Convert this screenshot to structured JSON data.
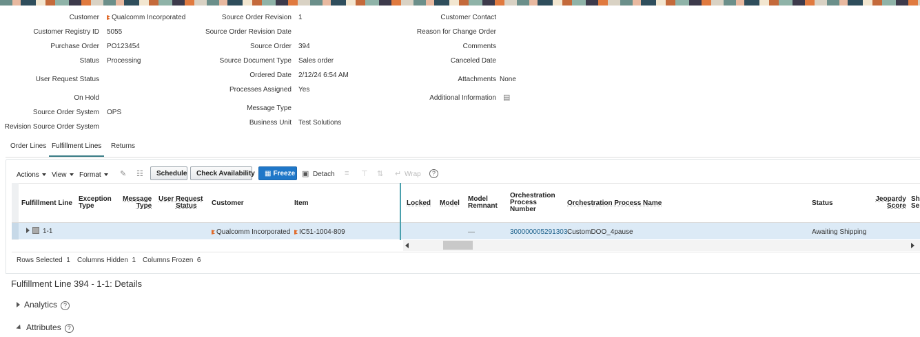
{
  "header_fields": {
    "col1": [
      {
        "label": "Customer",
        "value": "Qualcomm Incorporated"
      },
      {
        "label": "Customer Registry ID",
        "value": "5055"
      },
      {
        "label": "Purchase Order",
        "value": "PO123454"
      },
      {
        "label": "Status",
        "value": "Processing"
      },
      {
        "label": "User Request Status",
        "value": ""
      },
      {
        "label": "On Hold",
        "value": ""
      },
      {
        "label": "Source Order System",
        "value": "OPS"
      },
      {
        "label": "Revision Source Order System",
        "value": ""
      }
    ],
    "col2": [
      {
        "label": "Source Order Revision",
        "value": "1"
      },
      {
        "label": "Source Order Revision Date",
        "value": ""
      },
      {
        "label": "Source Order",
        "value": "394"
      },
      {
        "label": "Source Document Type",
        "value": "Sales order"
      },
      {
        "label": "Ordered Date",
        "value": "2/12/24 6:54 AM"
      },
      {
        "label": "Processes Assigned",
        "value": "Yes"
      },
      {
        "label": "Message Type",
        "value": ""
      },
      {
        "label": "Business Unit",
        "value": "Test Solutions"
      }
    ],
    "col3": [
      {
        "label": "Customer Contact",
        "value": ""
      },
      {
        "label": "Reason for Change Order",
        "value": ""
      },
      {
        "label": "Comments",
        "value": ""
      },
      {
        "label": "Canceled Date",
        "value": ""
      },
      {
        "label": "Attachments",
        "value": "None"
      },
      {
        "label": "Additional Information",
        "value": ""
      }
    ]
  },
  "tabs": [
    "Order Lines",
    "Fulfillment Lines",
    "Returns"
  ],
  "toolbar": {
    "actions": "Actions",
    "view": "View",
    "format": "Format",
    "schedule": "Schedule",
    "check_availability": "Check Availability",
    "freeze": "Freeze",
    "detach": "Detach",
    "wrap": "Wrap"
  },
  "columns": {
    "fulfillment_line": "Fulfillment Line",
    "exception_type_1": "Exception",
    "exception_type_2": "Type",
    "message_type_1": "Message",
    "message_type_2": "Type",
    "user_request_1": "User Request",
    "user_request_2": "Status",
    "customer": "Customer",
    "item": "Item",
    "locked": "Locked",
    "model": "Model",
    "model_remnant_1": "Model",
    "model_remnant_2": "Remnant",
    "orch_num_1": "Orchestration",
    "orch_num_2": "Process",
    "orch_num_3": "Number",
    "orch_name": "Orchestration Process Name",
    "status": "Status",
    "jeopardy_1": "Jeopardy",
    "jeopardy_2": "Score",
    "cut_1": "Sh",
    "cut_2": "Se"
  },
  "row": {
    "fulfillment_line": "1-1",
    "customer": "Qualcomm Incorporated",
    "item": "IC51-1004-809",
    "model_remnant": "—",
    "orch_number": "300000005291303·",
    "orch_name": "CustomDOO_4pause",
    "status": "Awaiting Shipping"
  },
  "table_status": {
    "rows_selected_label": "Rows Selected",
    "rows_selected": "1",
    "columns_hidden_label": "Columns Hidden",
    "columns_hidden": "1",
    "columns_frozen_label": "Columns Frozen",
    "columns_frozen": "6"
  },
  "details_title": "Fulfillment Line 394 - 1-1: Details",
  "sections": {
    "analytics": "Analytics",
    "attributes": "Attributes"
  },
  "colors": {
    "accent": "#3a7d87",
    "primary": "#1f77c8",
    "row_selected": "#dceaf6",
    "link": "#1a5f8a"
  }
}
